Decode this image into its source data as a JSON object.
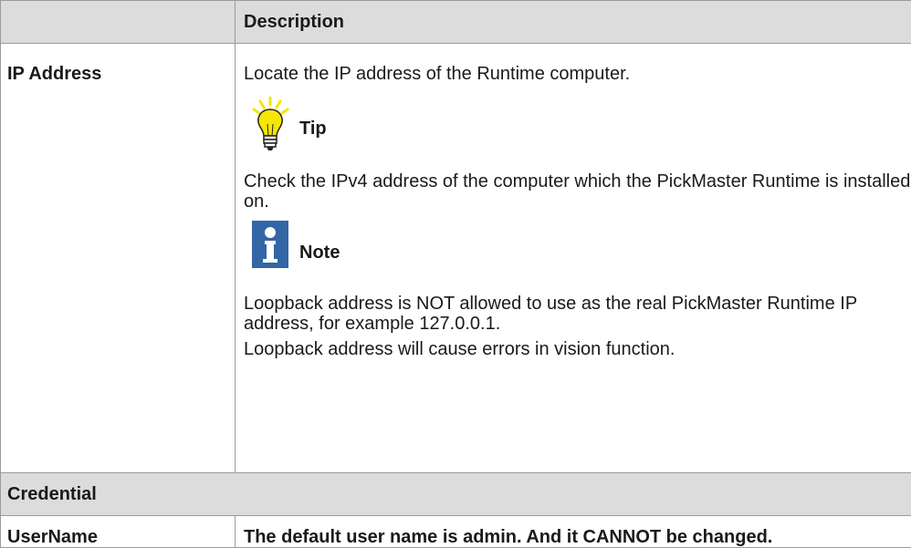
{
  "table": {
    "header": {
      "left": "",
      "right": "Description"
    },
    "ip_row": {
      "label": "IP Address",
      "locate_text": "Locate the IP address of the Runtime computer.",
      "tip": {
        "icon": "lightbulb-icon",
        "title": "Tip",
        "text": "Check the IPv4 address of the computer which the PickMaster Runtime is installed on."
      },
      "note": {
        "icon": "info-icon",
        "title": "Note",
        "text1": "Loopback address is NOT allowed to use as the real PickMaster Runtime IP address, for example 127.0.0.1.",
        "text2": "Loopback address will cause errors in vision function."
      }
    },
    "credential_row": {
      "label": "Credential"
    },
    "username_row": {
      "label": "UserName",
      "desc": "The default user name is admin. And it CANNOT be changed."
    }
  },
  "colors": {
    "header_bg": "#dcdcdc",
    "border": "#9a9a9a",
    "tip_yellow": "#f6e600",
    "note_blue": "#3366a6"
  }
}
